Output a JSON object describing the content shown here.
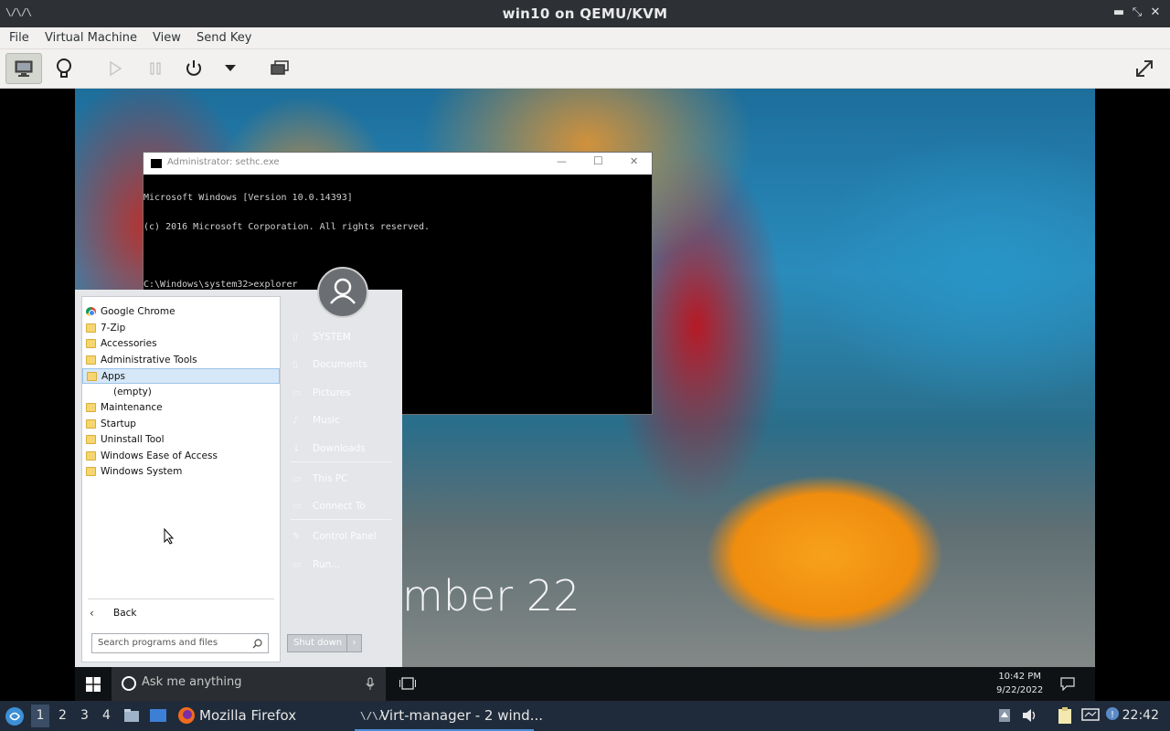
{
  "window": {
    "title": "win10 on QEMU/KVM",
    "app_icon_glyph": "\\/\\/\\",
    "minimize_glyph": "▬",
    "maximize_glyph": "⤡",
    "close_glyph": "✕"
  },
  "menubar": {
    "items": [
      "File",
      "Virtual Machine",
      "View",
      "Send Key"
    ]
  },
  "toolbar": {
    "buttons": [
      {
        "icon": "monitor-icon",
        "active": true
      },
      {
        "icon": "lightbulb-icon",
        "active": false
      },
      {
        "icon": "play-icon",
        "active": false
      },
      {
        "icon": "pause-icon",
        "active": false
      },
      {
        "icon": "power-icon",
        "active": false
      },
      {
        "icon": "chevron-down-icon",
        "active": false
      },
      {
        "icon": "screenshot-icon",
        "active": false
      },
      {
        "icon": "fullscreen-icon",
        "active": false
      }
    ]
  },
  "guest": {
    "date_text": "mber 22",
    "cmd": {
      "title": "Administrator: sethc.exe",
      "lines": [
        "Microsoft Windows [Version 10.0.14393]",
        "(c) 2016 Microsoft Corporation. All rights reserved.",
        "",
        "C:\\Windows\\system32>explorer",
        "",
        "C:\\Windows\\system32>"
      ],
      "minimize_glyph": "—",
      "maximize_glyph": "☐",
      "close_glyph": "✕"
    },
    "start_menu": {
      "programs": [
        {
          "label": "Google Chrome",
          "icon": "chrome-icon"
        },
        {
          "label": "7-Zip",
          "icon": "folder-icon"
        },
        {
          "label": "Accessories",
          "icon": "folder-icon"
        },
        {
          "label": "Administrative Tools",
          "icon": "folder-icon"
        },
        {
          "label": "Apps",
          "icon": "folder-icon",
          "selected": true
        },
        {
          "label": "(empty)",
          "icon": "",
          "indent": true
        },
        {
          "label": "Maintenance",
          "icon": "folder-icon"
        },
        {
          "label": "Startup",
          "icon": "folder-icon"
        },
        {
          "label": "Uninstall Tool",
          "icon": "folder-icon"
        },
        {
          "label": "Windows Ease of Access",
          "icon": "folder-icon"
        },
        {
          "label": "Windows System",
          "icon": "folder-icon"
        }
      ],
      "back_label": "Back",
      "search_placeholder": "Search programs and files",
      "right_items": [
        "SYSTEM",
        "Documents",
        "Pictures",
        "Music",
        "Downloads",
        "This PC",
        "Connect To",
        "Control Panel",
        "Run..."
      ],
      "shutdown_label": "Shut down",
      "shutdown_arrow": "›"
    },
    "taskbar": {
      "search_placeholder": "Ask me anything",
      "time": "10:42 PM",
      "date": "9/22/2022"
    }
  },
  "panel": {
    "workspaces": [
      "1",
      "2",
      "3",
      "4"
    ],
    "current_workspace": "1",
    "tasks": [
      {
        "label": "Mozilla Firefox",
        "icon": "firefox-icon",
        "active": false
      },
      {
        "label": "Virt-manager - 2 wind...",
        "icon": "virt-manager-icon",
        "active": true
      }
    ],
    "clock": "22:42"
  }
}
